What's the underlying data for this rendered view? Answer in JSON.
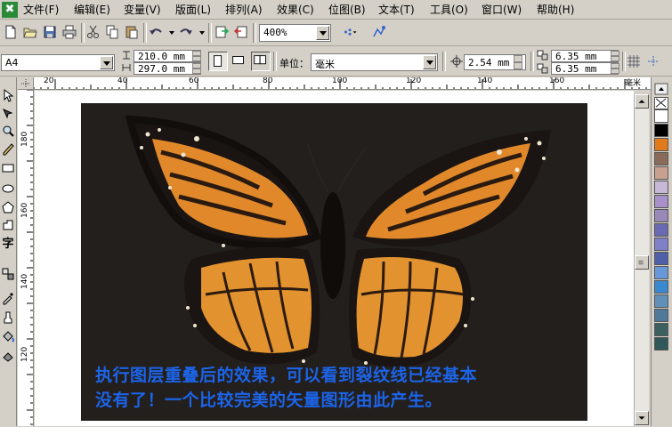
{
  "app": {
    "icon_glyph": "✖"
  },
  "menu": [
    "文件(F)",
    "编辑(E)",
    "变量(V)",
    "版面(L)",
    "排列(A)",
    "效果(C)",
    "位图(B)",
    "文本(T)",
    "工具(O)",
    "窗口(W)",
    "帮助(H)"
  ],
  "toolbar": {
    "zoom": "400%"
  },
  "propbar": {
    "page_size": "A4",
    "width": "210.0 mm",
    "height": "297.0 mm",
    "units_label": "单位：",
    "units_value": "毫米",
    "nudge": "2.54 mm",
    "dup_x": "6.35 mm",
    "dup_y": "6.35 mm"
  },
  "ruler": {
    "h_labels": [
      "20",
      "40",
      "60",
      "80",
      "100",
      "120",
      "140",
      "160"
    ],
    "h_unit": "毫米",
    "v_labels": [
      "180",
      "160",
      "140",
      "120"
    ]
  },
  "canvas": {
    "caption_line1": "执行图层重叠后的效果，可以看到裂纹线已经基本",
    "caption_line2": "没有了！一个比较完美的矢量图形由此产生。"
  },
  "palette": {
    "colors": [
      "#ffffff",
      "#000000",
      "#e07a1a",
      "#8a6a5a",
      "#c8a090",
      "#c8b8d8",
      "#a890c8",
      "#9888b8",
      "#6a6ab0",
      "#8080c8",
      "#5060a8",
      "#6898d8",
      "#3a88d0",
      "#6090b8",
      "#507898",
      "#3a6060",
      "#305858"
    ]
  },
  "colors": {
    "caption": "#1c64e8",
    "image_bg": "#231f1d"
  },
  "icons": [
    "new-doc-icon",
    "open-icon",
    "save-icon",
    "print-icon",
    "cut-icon",
    "copy-icon",
    "paste-icon",
    "undo-icon",
    "redo-icon",
    "import-icon",
    "export-icon",
    "pick-tool-icon",
    "shape-tool-icon",
    "zoom-tool-icon",
    "freehand-tool-icon",
    "rectangle-tool-icon",
    "ellipse-tool-icon",
    "polygon-tool-icon",
    "text-tool-icon",
    "butterfly-image"
  ]
}
